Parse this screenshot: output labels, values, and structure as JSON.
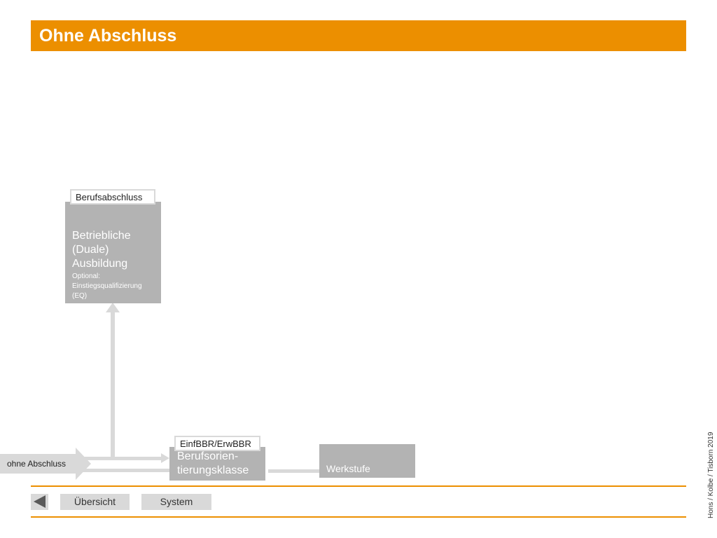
{
  "title": "Ohne Abschluss",
  "colors": {
    "accent": "#ec8f00",
    "box": "#b3b3b3",
    "arrow": "#d9d9d9"
  },
  "diagram": {
    "box_ausbildung": {
      "tag": "Berufsabschluss",
      "line1": "Betriebliche",
      "line2": "(Duale)",
      "line3": "Ausbildung",
      "note1": "Optional:",
      "note2": "Einstiegsqualifizierung",
      "note3": "(EQ)"
    },
    "box_berufsorientierung": {
      "tag": "EinfBBR/ErwBBR",
      "line1": "Berufsorien-",
      "line2": "tierungsklasse"
    },
    "box_werkstufe": {
      "label": "Werkstufe"
    },
    "entry_label": "ohne Abschluss"
  },
  "nav": {
    "back_icon": "triangle-left-icon",
    "overview": "Übersicht",
    "system": "System"
  },
  "credit": "Hons / Kolbe / Tisborn 2019"
}
